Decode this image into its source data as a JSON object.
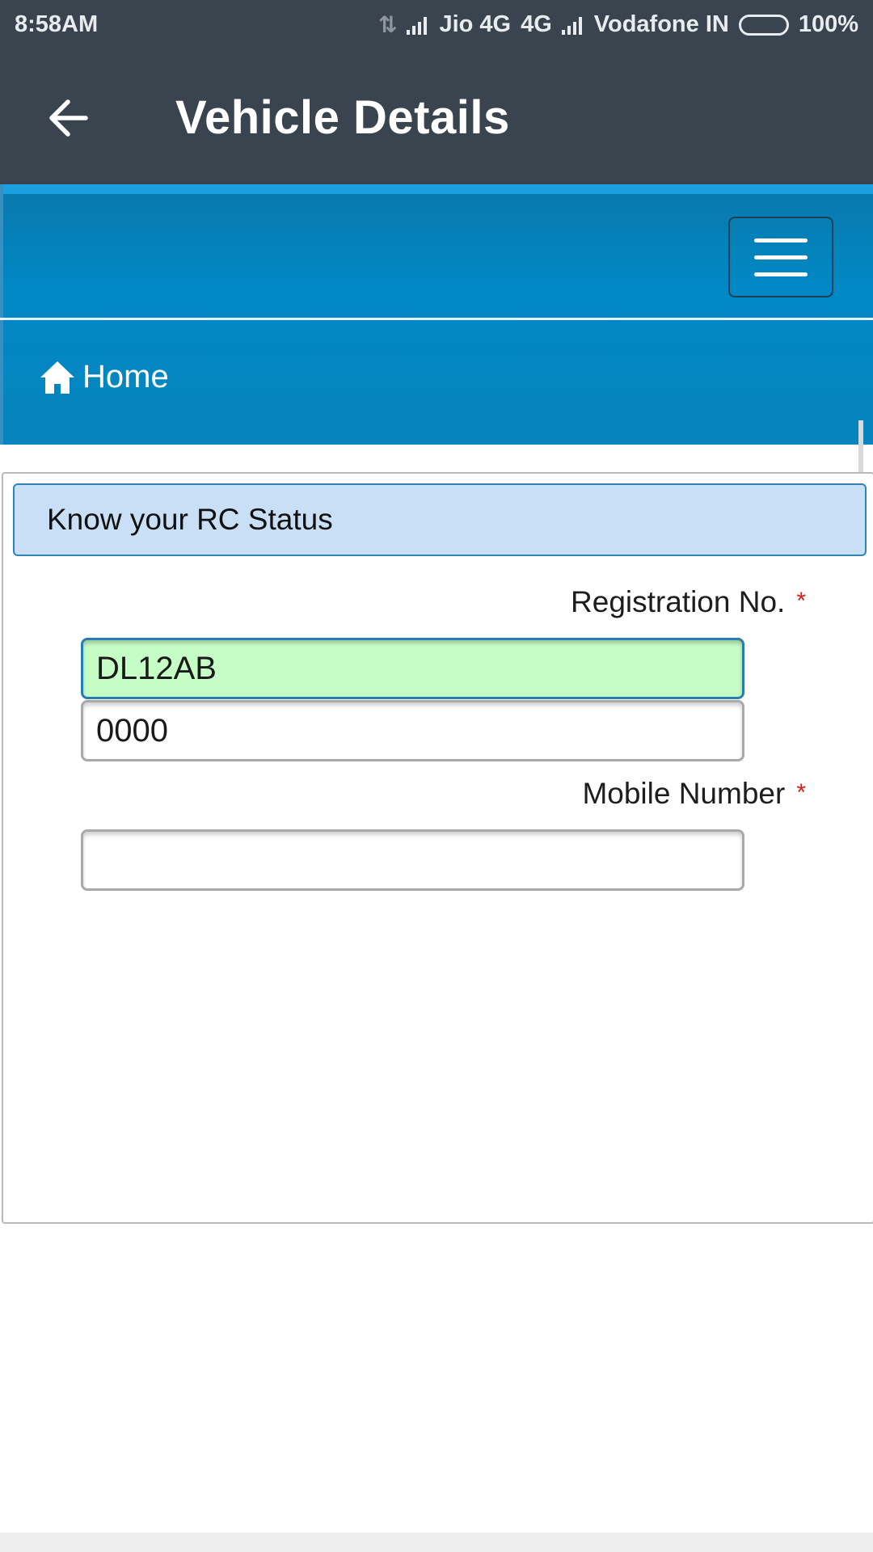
{
  "status_bar": {
    "time": "8:58AM",
    "carrier1": "Jio 4G",
    "network_type": "4G",
    "carrier2": "Vodafone IN",
    "battery": "100%"
  },
  "app_bar": {
    "title": "Vehicle Details"
  },
  "site_header": {
    "breadcrumb": "Home"
  },
  "form": {
    "heading": "Know your RC Status",
    "registration_label": "Registration No.",
    "registration_part1": "DL12AB",
    "registration_part2": "0000",
    "mobile_label": "Mobile Number",
    "mobile_value": "",
    "required_mark": "*"
  },
  "colors": {
    "app_bar": "#3a444e",
    "header_blue": "#0088c5",
    "panel_heading_bg": "#c8dff5",
    "focused_input_bg": "#c6fcc6",
    "required": "#d21f1f"
  },
  "icons": [
    "back-arrow-icon",
    "hamburger-menu-icon",
    "home-icon",
    "signal-icon",
    "battery-icon",
    "data-transfer-icon"
  ]
}
